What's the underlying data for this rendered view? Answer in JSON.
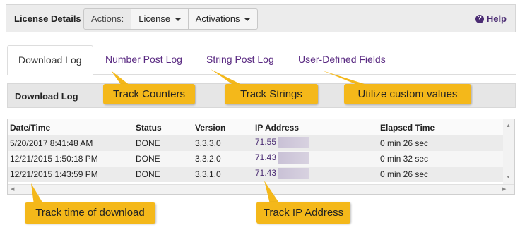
{
  "topbar": {
    "title": "License Details",
    "actions_label": "Actions:",
    "license_label": "License",
    "activations_label": "Activations",
    "help_label": "Help"
  },
  "tabs": [
    {
      "label": "Download Log",
      "active": true
    },
    {
      "label": "Number Post Log",
      "active": false
    },
    {
      "label": "String Post Log",
      "active": false
    },
    {
      "label": "User-Defined Fields",
      "active": false
    }
  ],
  "section": {
    "title": "Download Log"
  },
  "table": {
    "columns": [
      "Date/Time",
      "Status",
      "Version",
      "IP Address",
      "Elapsed Time"
    ],
    "rows": [
      {
        "datetime": "5/20/2017 8:41:48 AM",
        "status": "DONE",
        "version": "3.3.3.0",
        "ip": "71.55",
        "elapsed": "0 min 26 sec"
      },
      {
        "datetime": "12/21/2015 1:50:18 PM",
        "status": "DONE",
        "version": "3.3.2.0",
        "ip": "71.43",
        "elapsed": "0 min 32 sec"
      },
      {
        "datetime": "12/21/2015 1:43:59 PM",
        "status": "DONE",
        "version": "3.3.1.0",
        "ip": "71.43",
        "elapsed": "0 min 26 sec"
      }
    ]
  },
  "callouts": {
    "counters": "Track Counters",
    "strings": "Track Strings",
    "custom": "Utilize custom values",
    "time": "Track time of download",
    "ip": "Track IP Address"
  },
  "icons": {
    "help": "question-circle-icon",
    "caret": "caret-down-icon",
    "scroll_up": "scroll-up-arrow-icon",
    "scroll_down": "scroll-down-arrow-icon",
    "scroll_left": "scroll-left-arrow-icon",
    "scroll_right": "scroll-right-arrow-icon"
  },
  "colors": {
    "accent": "#4b2c73",
    "callout": "#f4b81a",
    "link": "#5a2a82"
  }
}
